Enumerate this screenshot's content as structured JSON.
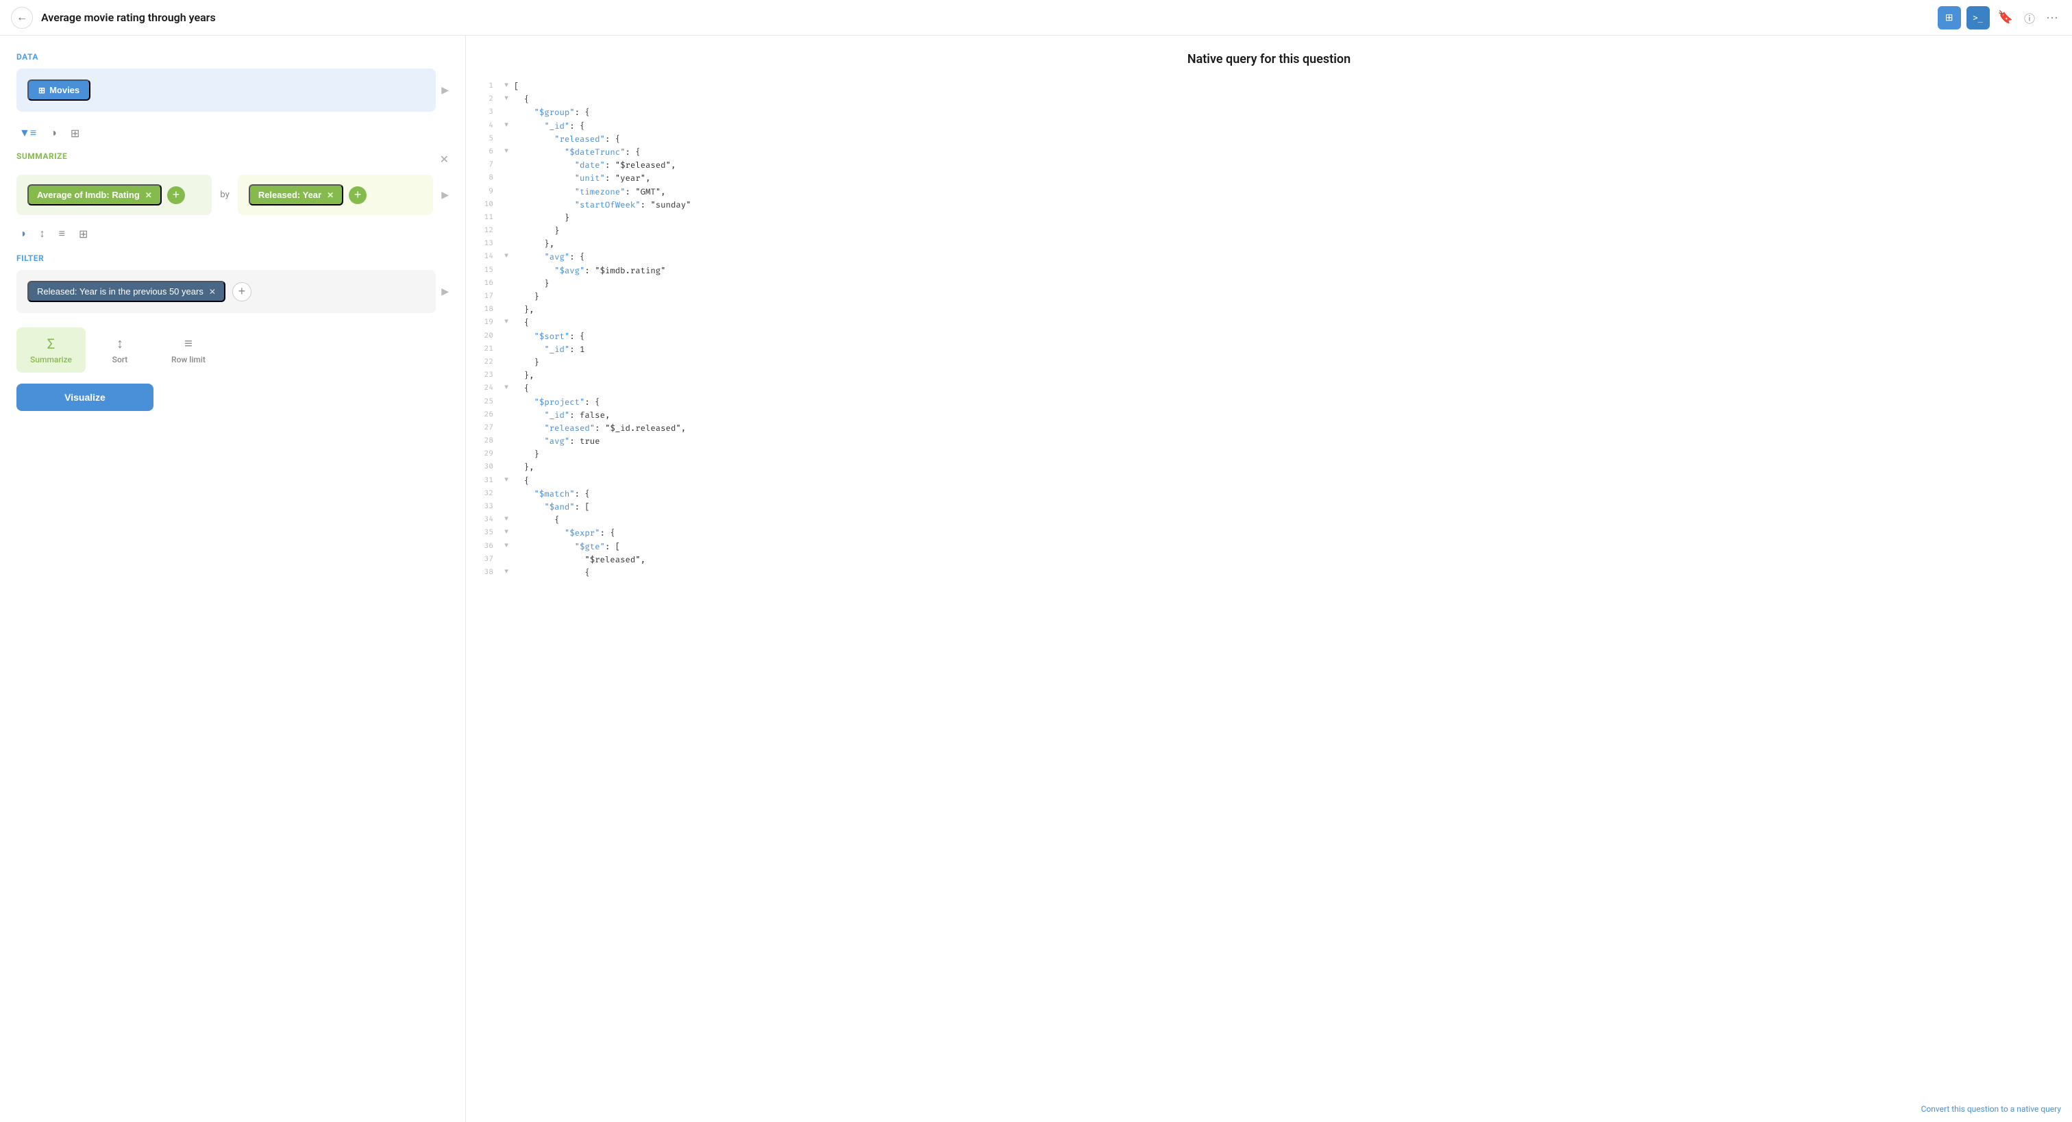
{
  "header": {
    "title": "Average movie rating through years",
    "back_label": "←",
    "btn_grid_label": "⊞",
    "btn_terminal_label": ">_",
    "bookmark_label": "🔖",
    "info_label": "i",
    "more_label": "···"
  },
  "left": {
    "data_label": "Data",
    "data_chip_label": "Movies",
    "summarize_label": "Summarize",
    "metric_chip": "Average of Imdb: Rating",
    "by_label": "by",
    "group_chip": "Released: Year",
    "filter_label": "Filter",
    "filter_chip": "Released: Year is in the previous 50 years",
    "toolbar": {
      "summarize": "Summarize",
      "sort": "Sort",
      "row_limit": "Row limit"
    },
    "visualize_btn": "Visualize"
  },
  "right": {
    "title": "Native query for this question",
    "convert_link": "Convert this question to a native query",
    "lines": [
      {
        "num": "1",
        "toggle": "▼",
        "content": "["
      },
      {
        "num": "2",
        "toggle": "▼",
        "content": "  {"
      },
      {
        "num": "3",
        "toggle": " ",
        "content": "    \"$group\": {"
      },
      {
        "num": "4",
        "toggle": "▼",
        "content": "      \"_id\": {"
      },
      {
        "num": "5",
        "toggle": " ",
        "content": "        \"released\": {"
      },
      {
        "num": "6",
        "toggle": "▼",
        "content": "          \"$dateTrunc\": {"
      },
      {
        "num": "7",
        "toggle": " ",
        "content": "            \"date\": \"$released\","
      },
      {
        "num": "8",
        "toggle": " ",
        "content": "            \"unit\": \"year\","
      },
      {
        "num": "9",
        "toggle": " ",
        "content": "            \"timezone\": \"GMT\","
      },
      {
        "num": "10",
        "toggle": " ",
        "content": "            \"startOfWeek\": \"sunday\""
      },
      {
        "num": "11",
        "toggle": " ",
        "content": "          }"
      },
      {
        "num": "12",
        "toggle": " ",
        "content": "        }"
      },
      {
        "num": "13",
        "toggle": " ",
        "content": "      },"
      },
      {
        "num": "14",
        "toggle": "▼",
        "content": "      \"avg\": {"
      },
      {
        "num": "15",
        "toggle": " ",
        "content": "        \"$avg\": \"$imdb.rating\""
      },
      {
        "num": "16",
        "toggle": " ",
        "content": "      }"
      },
      {
        "num": "17",
        "toggle": " ",
        "content": "    }"
      },
      {
        "num": "18",
        "toggle": " ",
        "content": "  },"
      },
      {
        "num": "19",
        "toggle": "▼",
        "content": "  {"
      },
      {
        "num": "20",
        "toggle": " ",
        "content": "    \"$sort\": {"
      },
      {
        "num": "21",
        "toggle": " ",
        "content": "      \"_id\": 1"
      },
      {
        "num": "22",
        "toggle": " ",
        "content": "    }"
      },
      {
        "num": "23",
        "toggle": " ",
        "content": "  },"
      },
      {
        "num": "24",
        "toggle": "▼",
        "content": "  {"
      },
      {
        "num": "25",
        "toggle": " ",
        "content": "    \"$project\": {"
      },
      {
        "num": "26",
        "toggle": " ",
        "content": "      \"_id\": false,"
      },
      {
        "num": "27",
        "toggle": " ",
        "content": "      \"released\": \"$_id.released\","
      },
      {
        "num": "28",
        "toggle": " ",
        "content": "      \"avg\": true"
      },
      {
        "num": "29",
        "toggle": " ",
        "content": "    }"
      },
      {
        "num": "30",
        "toggle": " ",
        "content": "  },"
      },
      {
        "num": "31",
        "toggle": "▼",
        "content": "  {"
      },
      {
        "num": "32",
        "toggle": " ",
        "content": "    \"$match\": {"
      },
      {
        "num": "33",
        "toggle": " ",
        "content": "      \"$and\": ["
      },
      {
        "num": "34",
        "toggle": "▼",
        "content": "        {"
      },
      {
        "num": "35",
        "toggle": "▼",
        "content": "          \"$expr\": {"
      },
      {
        "num": "36",
        "toggle": "▼",
        "content": "            \"$gte\": ["
      },
      {
        "num": "37",
        "toggle": " ",
        "content": "              \"$released\","
      },
      {
        "num": "38",
        "toggle": "▼",
        "content": "              {"
      }
    ]
  }
}
